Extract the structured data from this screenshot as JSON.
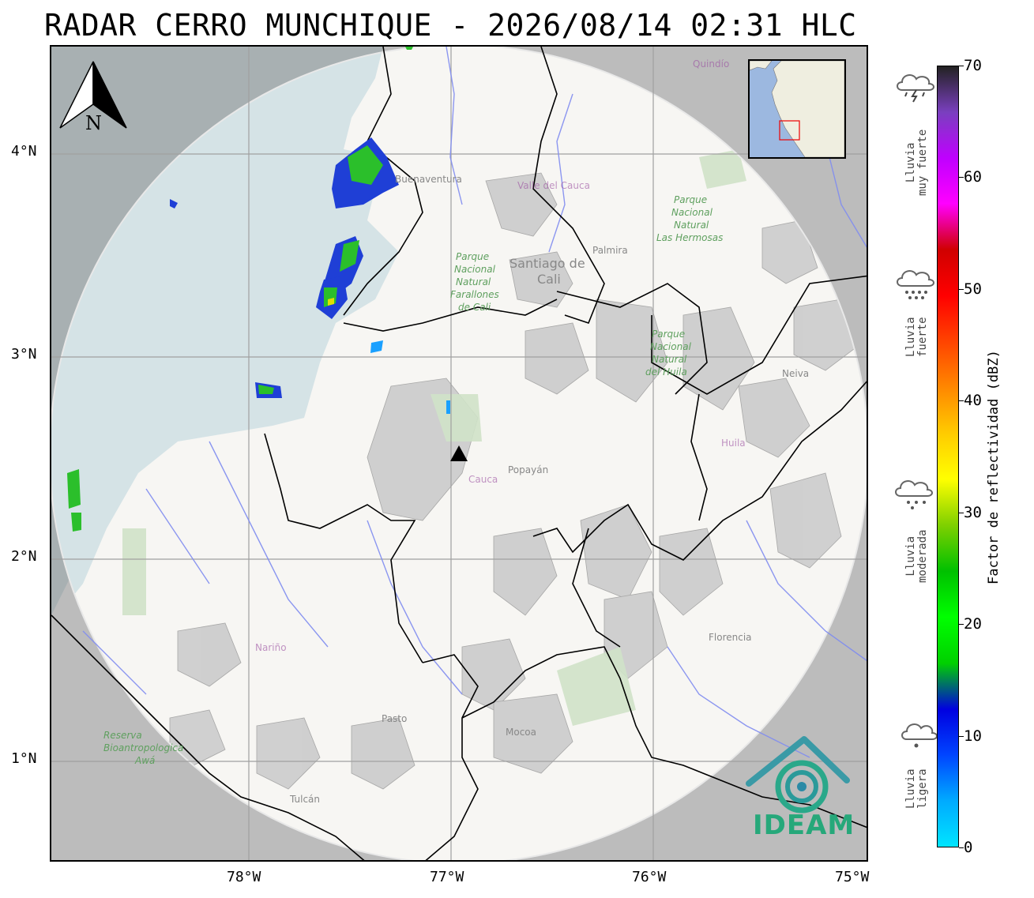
{
  "title": "RADAR CERRO MUNCHIQUE - 2026/08/14 02:31 HLC",
  "compass": {
    "label": "N"
  },
  "lat_labels": [
    "4°N",
    "3°N",
    "2°N",
    "1°N"
  ],
  "lon_labels": [
    "78°W",
    "77°W",
    "76°W",
    "75°W"
  ],
  "places": {
    "quindio": "Quindío",
    "buenaventura": "Buenaventura",
    "valle": "Valle del Cauca",
    "pnn_farallones": [
      "Parque",
      "Nacional",
      "Natural",
      "Farallones",
      "de Cali"
    ],
    "santiago": [
      "Santiago de",
      "Cali"
    ],
    "palmira": "Palmira",
    "pnn_hermosas": [
      "Parque",
      "Nacional",
      "Natural",
      "Las Hermosas"
    ],
    "pnn_huila": [
      "Parque",
      "Nacional",
      "Natural",
      "del Huila"
    ],
    "neiva": "Neiva",
    "huila": "Huila",
    "cauca": "Cauca",
    "popayan": "Popayán",
    "narino": "Nariño",
    "florencia": "Florencia",
    "pasto": "Pasto",
    "mocoa": "Mocoa",
    "reserva": [
      "Reserva",
      "Bioantropologica",
      "Awá"
    ],
    "tulcan": "Tulcán"
  },
  "legend": [
    {
      "icon": "thunderstorm-cloud-icon",
      "label": "Lluvia\nmuy fuerte"
    },
    {
      "icon": "heavy-rain-cloud-icon",
      "label": "Lluvia\nfuerte"
    },
    {
      "icon": "moderate-rain-cloud-icon",
      "label": "Lluvia\nmoderada"
    },
    {
      "icon": "light-rain-cloud-icon",
      "label": "Lluvia\nligera"
    }
  ],
  "colorbar": {
    "title": "Factor de reflectividad (dBZ)",
    "min": 0,
    "max": 70,
    "ticks": [
      "0",
      "10",
      "20",
      "30",
      "40",
      "50",
      "60",
      "70"
    ],
    "colors": [
      "#00e5ff",
      "#00aaff",
      "#0044ff",
      "#0000e0",
      "#00d000",
      "#00ff00",
      "#00c000",
      "#7fd000",
      "#ffff00",
      "#ffcc00",
      "#ff8800",
      "#ff4400",
      "#ff0000",
      "#d00000",
      "#ff00ff",
      "#c000ff",
      "#7a3fbf",
      "#222222"
    ]
  },
  "logo": {
    "text": "IDEAM"
  }
}
